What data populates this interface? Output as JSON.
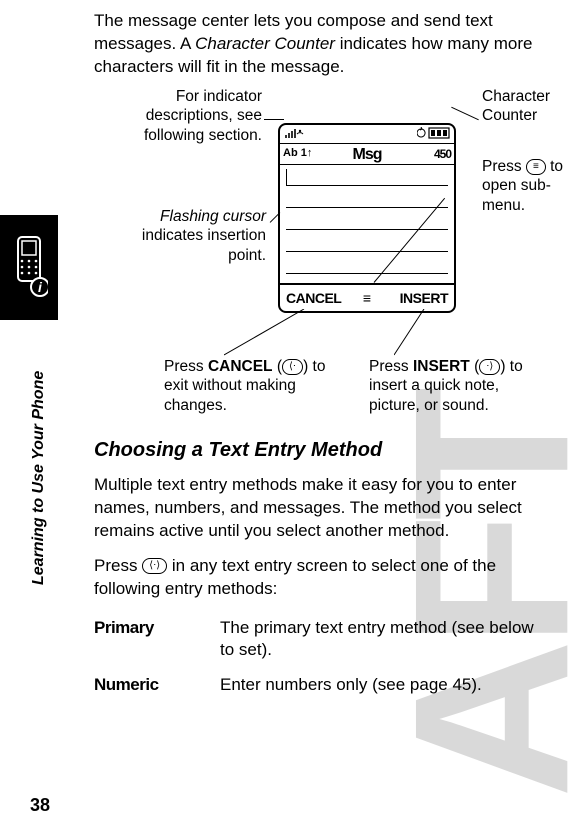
{
  "page_number": "38",
  "sidebar_title": "Learning to Use Your Phone",
  "intro_before_italic": "The message center lets you compose and send text messages. A ",
  "intro_italic": "Character Counter",
  "intro_after_italic": " indicates how many more characters will fit in the message.",
  "screen": {
    "signal_icon_text": "▮▯▯▯",
    "battery_icon_text": "⟳ ▣▣▣",
    "mode_left": "Ab 1↑",
    "title": "Msg",
    "counter": "450",
    "softkey_left": "CANCEL",
    "softkey_center": "≡",
    "softkey_right": "INSERT"
  },
  "callouts": {
    "indicators": "For indicator descriptions, see following section.",
    "cursor_prefix_italic": "Flashing cursor",
    "cursor_rest": " indicates insertion point.",
    "character_counter": "Character Counter",
    "submenu_prefix": "Press ",
    "submenu_key": "≡",
    "submenu_suffix": " to open sub-menu.",
    "cancel_prefix": "Press ",
    "cancel_bold": "CANCEL",
    "cancel_paren_open": " (",
    "cancel_key": "⟨⋅",
    "cancel_paren_close": ") to exit without making changes.",
    "insert_prefix": "Press ",
    "insert_bold": "INSERT",
    "insert_paren_open": " (",
    "insert_key": "⋅⟩",
    "insert_paren_close": ") to insert a quick note, picture, or sound."
  },
  "section_heading": "Choosing a Text Entry Method",
  "section_p1": "Multiple text entry methods make it easy for you to enter names, numbers, and messages. The method you select remains active until you select another method.",
  "section_p2_prefix": "Press ",
  "section_p2_key": "⟨⋅⟩",
  "section_p2_suffix": " in any text entry screen to select one of the following entry methods:",
  "methods": {
    "primary_name": "Primary",
    "primary_desc": "The primary text entry method (see below to set).",
    "numeric_name": "Numeric",
    "numeric_desc": "Enter numbers only (see page 45)."
  }
}
